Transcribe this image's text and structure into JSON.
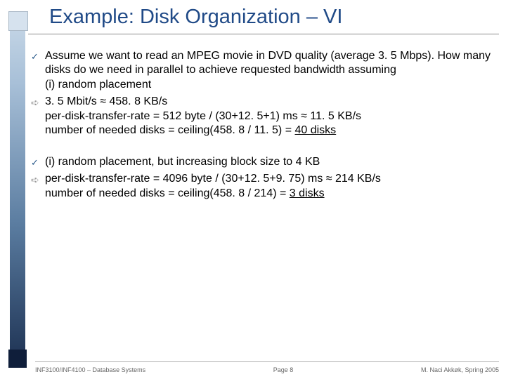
{
  "title": "Example: Disk Organization – VI",
  "bullets": {
    "b1": "Assume we want to read an MPEG movie in DVD quality (average 3. 5 Mbps). How many disks do we need in parallel to achieve requested bandwidth assuming",
    "b1a": "(i) random placement",
    "b2a": "3. 5 Mbit/s ≈ 458. 8 KB/s",
    "b2b": "per-disk-transfer-rate = 512 byte / (30+12. 5+1) ms ≈ 11. 5 KB/s",
    "b2c_pre": "number of needed disks = ceiling(458. 8 / 11. 5) = ",
    "b2c_u": "40 disks",
    "b3": "(i) random placement, but increasing block size to 4 KB",
    "b4a": "per-disk-transfer-rate = 4096 byte / (30+12. 5+9. 75) ms ≈ 214 KB/s",
    "b4b_pre": "number of needed disks = ceiling(458. 8 / 214) = ",
    "b4b_u": "3 disks"
  },
  "footer": {
    "left": "INF3100/INF4100 – Database Systems",
    "center": "Page 8",
    "right": "M. Naci Akkøk, Spring 2005"
  }
}
